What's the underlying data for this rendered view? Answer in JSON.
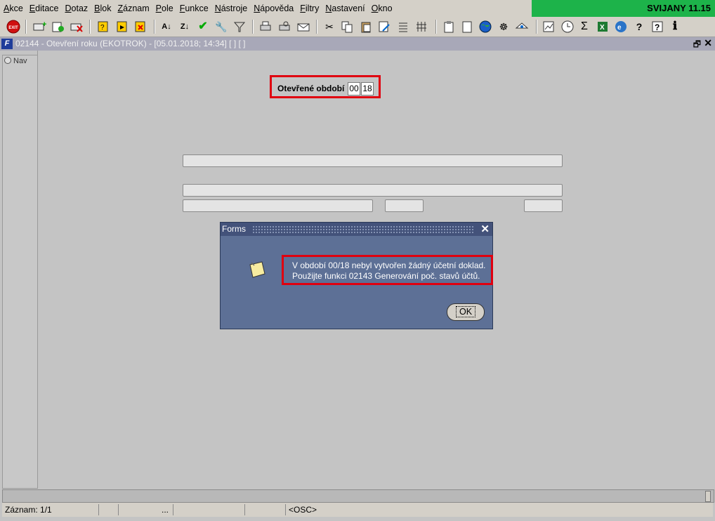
{
  "menu": [
    "Akce",
    "Editace",
    "Dotaz",
    "Blok",
    "Záznam",
    "Pole",
    "Funkce",
    "Nástroje",
    "Nápověda",
    "Filtry",
    "Nastavení",
    "Okno"
  ],
  "brand": "SVIJANY 11.15",
  "toolbar": {
    "exit_label": "EXIT",
    "icons": [
      "exit-icon",
      "insert-record-icon",
      "new-record-icon",
      "delete-record-icon",
      "query-enter-icon",
      "query-execute-icon",
      "query-cancel-icon",
      "sort-asc-icon",
      "sort-desc-icon",
      "check-icon",
      "wrench-icon",
      "filter-icon",
      "print-icon",
      "print-preview-icon",
      "mail-icon",
      "cut-icon",
      "copy-icon",
      "paste-icon",
      "edit-icon",
      "list-icon",
      "columns-icon",
      "clipboard-icon",
      "document-icon",
      "globe-icon",
      "settings-wheel-icon",
      "eye-icon",
      "chart-icon",
      "clock-icon",
      "sum-icon",
      "excel-icon",
      "word-icon",
      "help-icon",
      "question-icon",
      "info-icon"
    ]
  },
  "window": {
    "title": "02144 - Otevření roku (EKOTROK) - [05.01.2018; 14:34]  [ ]  [ ]",
    "icon_label": "F"
  },
  "nav": {
    "label": "Nav"
  },
  "period": {
    "label": "Otevřené období",
    "month": "00",
    "year": "18"
  },
  "dialog": {
    "title": "Forms",
    "message_line1": "V období 00/18 nebyl vytvořen žádný účetní doklad.",
    "message_line2": "Použijte funkci 02143 Generování poč. stavů účtů.",
    "ok_label": "OK"
  },
  "status": {
    "record": "Záznam: 1/1",
    "dots": "...",
    "mode": "<OSC>"
  },
  "colors": {
    "brand_bg": "#1db34a",
    "highlight": "#e0000f",
    "dialog_bg": "#5d7096"
  }
}
